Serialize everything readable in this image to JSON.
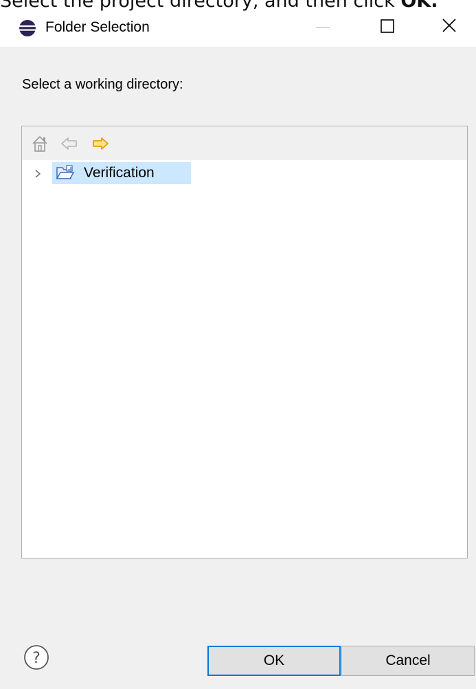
{
  "instruction": {
    "prefix": "Select the project directory, and then click ",
    "bold": "OK."
  },
  "dialog": {
    "title": "Folder Selection",
    "prompt": "Select a working directory:",
    "window_controls": {
      "minimize_icon": "minimize-icon",
      "maximize_icon": "maximize-icon",
      "close_icon": "close-icon"
    },
    "toolbar": {
      "home_icon": "home-icon",
      "back_icon": "arrow-left-icon",
      "forward_icon": "arrow-right-icon"
    },
    "tree": [
      {
        "label": "Verification",
        "expanded": false,
        "selected": true,
        "icon": "folder-open-icon"
      }
    ],
    "buttons": {
      "ok": "OK",
      "cancel": "Cancel"
    },
    "help_icon": "help-icon",
    "colors": {
      "selection": "#cce8ff",
      "default_button_border": "#0078d7",
      "forward_arrow": "#f5b400",
      "dialog_bg": "#f0f0f0"
    }
  }
}
